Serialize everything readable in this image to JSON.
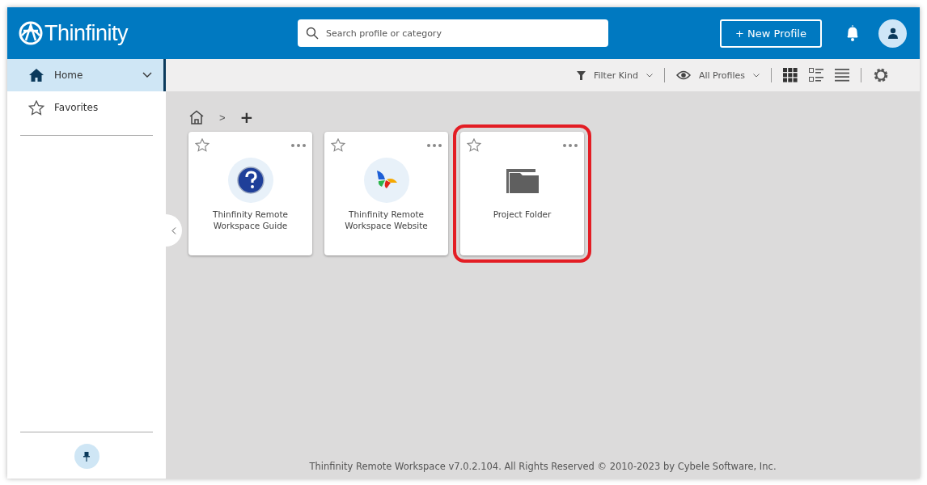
{
  "header": {
    "logo": "Thinfinity",
    "search": {
      "placeholder": "Search profile or category"
    },
    "new_button": "+ New Profile"
  },
  "sidebar": {
    "items": [
      {
        "label": "Home",
        "kind": "home",
        "selected": true
      },
      {
        "label": "Favorites",
        "kind": "star",
        "selected": false
      }
    ]
  },
  "toolbar": {
    "filter": "Filter Kind",
    "view_filter": "All Profiles",
    "views": [
      {
        "kind": "grid",
        "selected": true
      },
      {
        "kind": "details",
        "selected": false
      },
      {
        "kind": "list",
        "selected": false
      }
    ]
  },
  "breadcrumb": {
    "separator": ">",
    "add": "+"
  },
  "cards": [
    {
      "title": "Thinfinity Remote Workspace Guide",
      "kind": "help",
      "highlighted": false
    },
    {
      "title": "Thinfinity Remote Workspace Website",
      "kind": "web",
      "highlighted": false
    },
    {
      "title": "Project Folder",
      "kind": "folder",
      "highlighted": true
    }
  ],
  "footer": "Thinfinity Remote Workspace v7.0.2.104. All Rights Reserved © 2010-2023 by Cybele Software, Inc."
}
